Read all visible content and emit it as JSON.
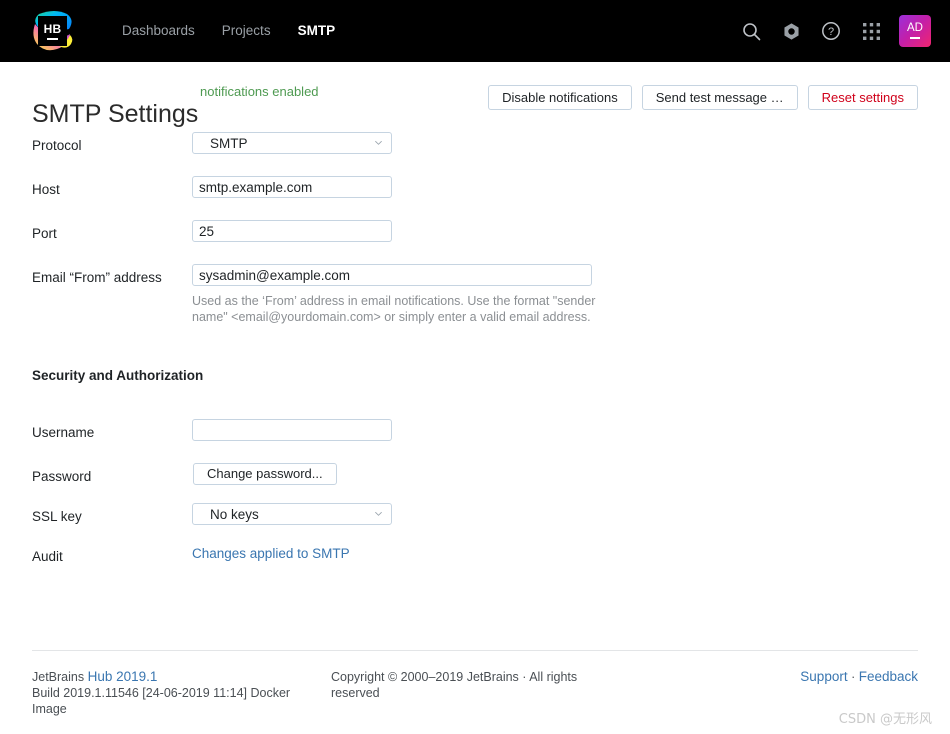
{
  "header": {
    "logo": {
      "text": "HB",
      "name": "hub-logo"
    },
    "nav": [
      {
        "label": "Dashboards",
        "active": false
      },
      {
        "label": "Projects",
        "active": false
      },
      {
        "label": "SMTP",
        "active": true
      }
    ],
    "icons": [
      "search-icon",
      "gear-icon",
      "help-icon",
      "apps-grid-icon"
    ],
    "avatar": {
      "initials": "AD"
    }
  },
  "title": {
    "heading": "SMTP Settings",
    "badge": "notifications enabled",
    "actions": [
      {
        "label": "Disable notifications",
        "style": "default"
      },
      {
        "label": "Send test message …",
        "style": "default"
      },
      {
        "label": "Reset settings",
        "style": "danger"
      }
    ]
  },
  "form": {
    "protocol": {
      "label": "Protocol",
      "value": "SMTP"
    },
    "host": {
      "label": "Host",
      "value": "smtp.example.com"
    },
    "port": {
      "label": "Port",
      "value": "25"
    },
    "email_from": {
      "label": "Email “From” address",
      "value": "sysadmin@example.com",
      "help": "Used as the ‘From’ address in email notifications. Use the format \"sender name\" <email@yourdomain.com> or simply enter a valid email address."
    },
    "security_section": "Security and Authorization",
    "username": {
      "label": "Username",
      "value": ""
    },
    "password": {
      "label": "Password",
      "button": "Change password..."
    },
    "ssl_key": {
      "label": "SSL key",
      "value": "No keys"
    },
    "audit": {
      "label": "Audit",
      "link": "Changes applied to SMTP"
    }
  },
  "footer": {
    "product_prefix": "JetBrains",
    "product_link": "Hub 2019.1",
    "build": "Build 2019.1.11546 [24-06-2019 11:14] Docker Image",
    "copyright": "Copyright © 2000–2019 JetBrains · All rights reserved",
    "support": "Support",
    "separator": " · ",
    "feedback": "Feedback"
  },
  "watermark": "CSDN @无形风",
  "colors": {
    "header_bg": "#000000",
    "accent_link": "#3a76b0",
    "success": "#4e9a51",
    "danger": "#d0021b",
    "border": "#c6d4e1"
  }
}
